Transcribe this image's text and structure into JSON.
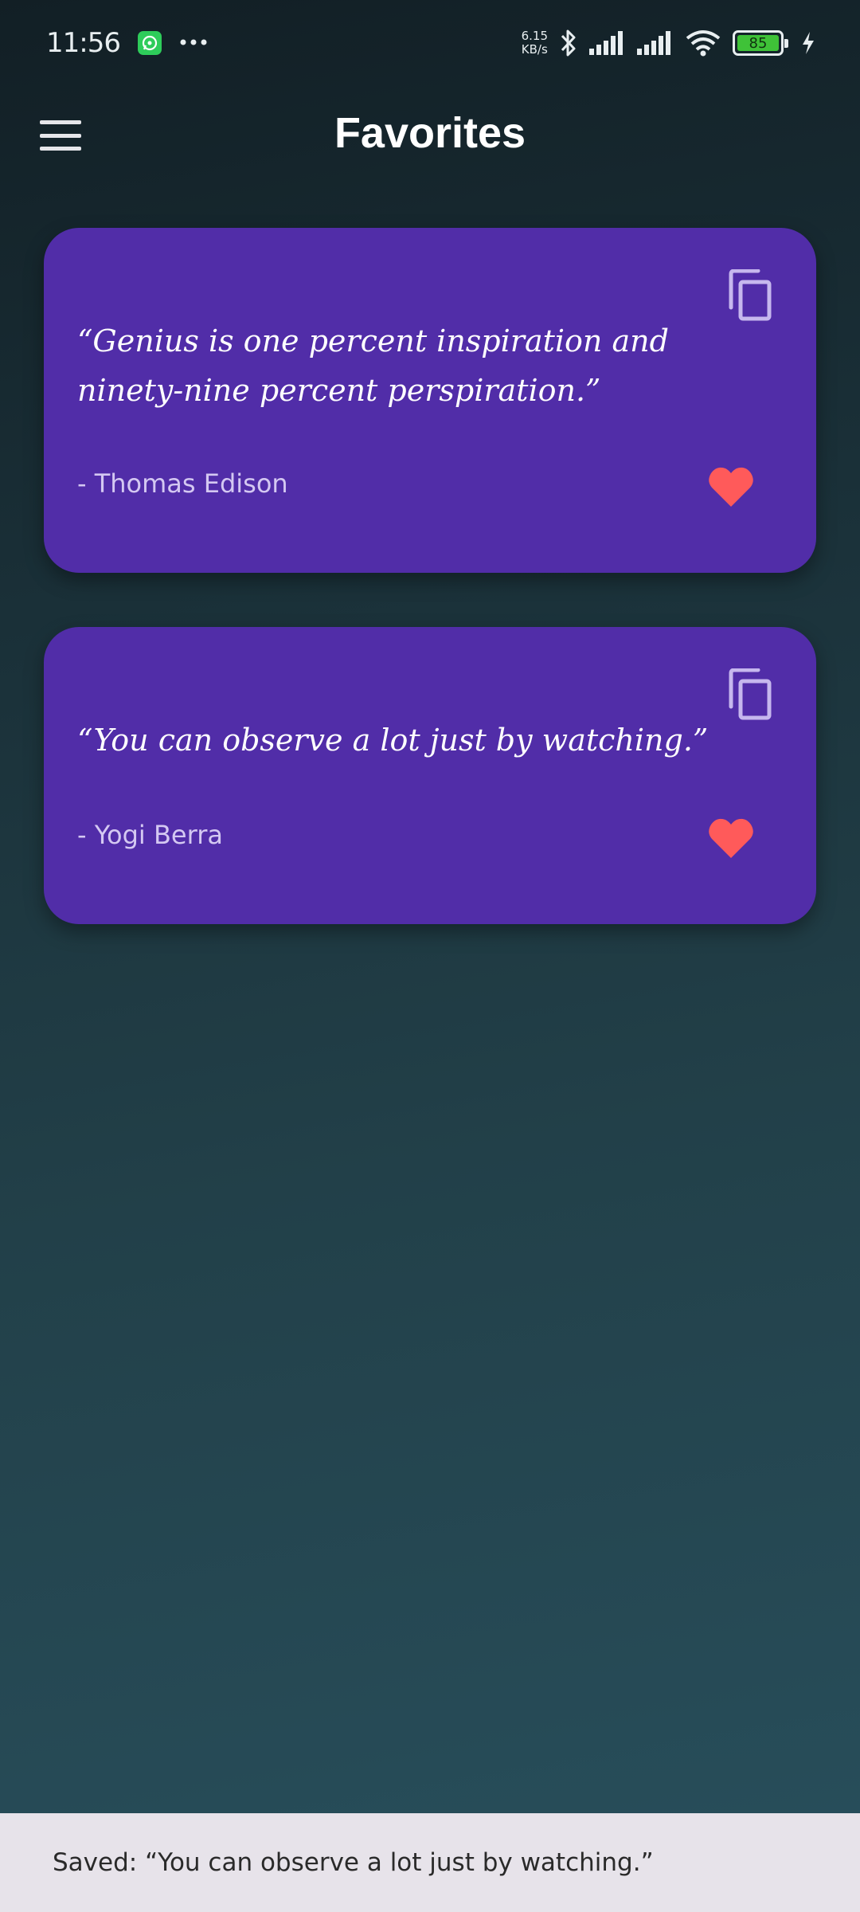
{
  "status_bar": {
    "time": "11:56",
    "net_speed_value": "6.15",
    "net_speed_unit": "KB/s",
    "battery_level": "85",
    "icons": [
      "whatsapp-icon",
      "more-dots-icon",
      "bluetooth-icon",
      "signal-icon",
      "signal-icon",
      "wifi-icon",
      "battery-icon",
      "charging-bolt-icon"
    ]
  },
  "app_bar": {
    "title": "Favorites",
    "menu_icon": "hamburger-menu-icon"
  },
  "colors": {
    "card_background": "#512da8",
    "heart": "#ff5a5a",
    "author_text": "#d4c8f2",
    "snackbar_background": "#e7e3ea"
  },
  "quotes": [
    {
      "text": "“Genius is one percent inspiration and ninety-nine percent perspiration.”",
      "author": "- Thomas Edison",
      "favorited": true
    },
    {
      "text": "“You can observe a lot just by watching.”",
      "author": "- Yogi Berra",
      "favorited": true
    }
  ],
  "snackbar": {
    "message": "Saved: “You can observe a lot just by watching.”"
  }
}
